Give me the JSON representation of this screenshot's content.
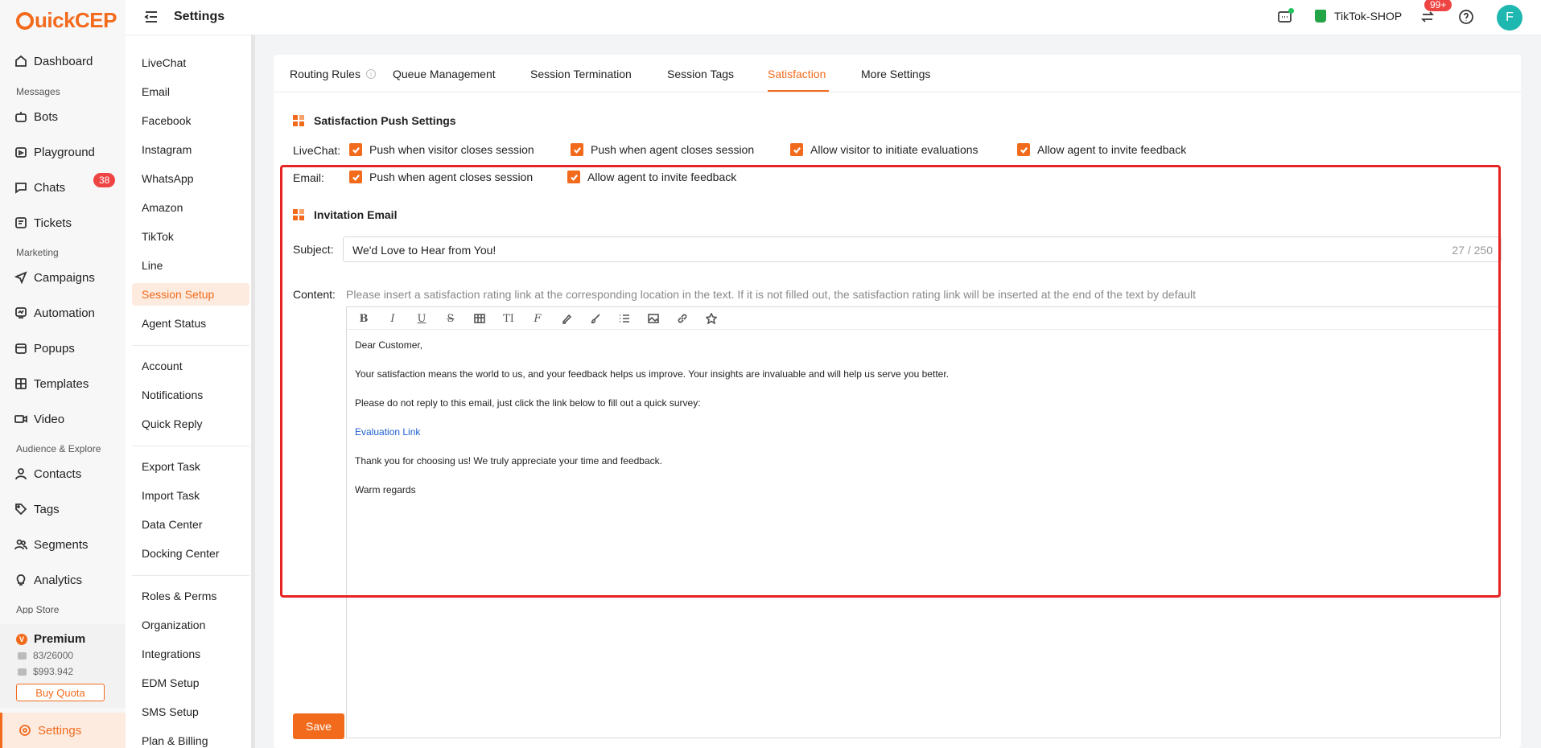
{
  "app": {
    "logo_text": "uickCEP",
    "logo_letter": "Q",
    "page_title": "Settings"
  },
  "leftnav": {
    "items": [
      {
        "label": "Dashboard",
        "icon": "home-icon"
      },
      {
        "label": "Bots",
        "icon": "bot-icon"
      },
      {
        "label": "Playground",
        "icon": "playground-icon"
      },
      {
        "label": "Chats",
        "icon": "chat-icon",
        "badge": "38"
      },
      {
        "label": "Tickets",
        "icon": "ticket-icon"
      },
      {
        "label": "Campaigns",
        "icon": "send-icon"
      },
      {
        "label": "Automation",
        "icon": "automation-icon"
      },
      {
        "label": "Popups",
        "icon": "popup-icon"
      },
      {
        "label": "Templates",
        "icon": "template-icon"
      },
      {
        "label": "Video",
        "icon": "video-icon"
      },
      {
        "label": "Contacts",
        "icon": "user-icon"
      },
      {
        "label": "Tags",
        "icon": "tag-icon"
      },
      {
        "label": "Segments",
        "icon": "segments-icon"
      },
      {
        "label": "Analytics",
        "icon": "bulb-icon"
      }
    ],
    "sections": {
      "messages": "Messages",
      "marketing": "Marketing",
      "audience": "Audience & Explore",
      "app_store": "App Store"
    },
    "premium": {
      "title": "Premium",
      "quota": "83/26000",
      "balance": "$993.942",
      "buy_label": "Buy Quota"
    },
    "settings_label": "Settings"
  },
  "topbar": {
    "shop_name": "TikTok-SHOP",
    "notif_badge": "99+",
    "avatar_letter": "F"
  },
  "submenu": {
    "group1": [
      "LiveChat",
      "Email",
      "Facebook",
      "Instagram",
      "WhatsApp",
      "Amazon",
      "TikTok",
      "Line",
      "Session Setup",
      "Agent Status"
    ],
    "group2": [
      "Account",
      "Notifications",
      "Quick Reply"
    ],
    "group3": [
      "Export Task",
      "Import Task",
      "Data Center",
      "Docking Center"
    ],
    "group4": [
      "Roles & Perms",
      "Organization",
      "Integrations",
      "EDM Setup",
      "SMS Setup",
      "Plan & Billing"
    ],
    "active": "Session Setup"
  },
  "tabs": [
    "Routing Rules",
    "Queue Management",
    "Session Termination",
    "Session Tags",
    "Satisfaction",
    "More Settings"
  ],
  "active_tab": "Satisfaction",
  "push_settings": {
    "title": "Satisfaction Push Settings",
    "livechat_label": "LiveChat:",
    "livechat_options": [
      {
        "label": "Push when visitor closes session",
        "checked": true
      },
      {
        "label": "Push when agent closes session",
        "checked": true
      },
      {
        "label": "Allow visitor to initiate evaluations",
        "checked": true
      },
      {
        "label": "Allow agent to invite feedback",
        "checked": true
      }
    ],
    "email_label": "Email:",
    "email_options": [
      {
        "label": "Push when agent closes session",
        "checked": true
      },
      {
        "label": "Allow agent to invite feedback",
        "checked": true
      }
    ]
  },
  "invitation": {
    "title": "Invitation Email",
    "subject_label": "Subject",
    "subject_value": "We'd Love to Hear from You!",
    "subject_count": "27 / 250",
    "content_label": "Content",
    "content_hint": "Please insert a satisfaction rating link at the corresponding location in the text. If it is not filled out, the satisfaction rating link will be inserted at the end of the text by default",
    "body": {
      "greeting": "Dear Customer,",
      "para1": "Your satisfaction means the world to us, and your feedback helps us improve. Your insights are invaluable and will help us serve you better.",
      "para2": "Please do not reply to this email, just click the link below to fill out a quick survey:",
      "link": "Evaluation Link",
      "para3": "Thank you for choosing us! We truly appreciate your time and feedback.",
      "closing": "Warm regards"
    }
  },
  "save_label": "Save",
  "colors": {
    "accent": "#f26b1d",
    "highlight": "#e62424",
    "link": "#1f5fd1"
  }
}
